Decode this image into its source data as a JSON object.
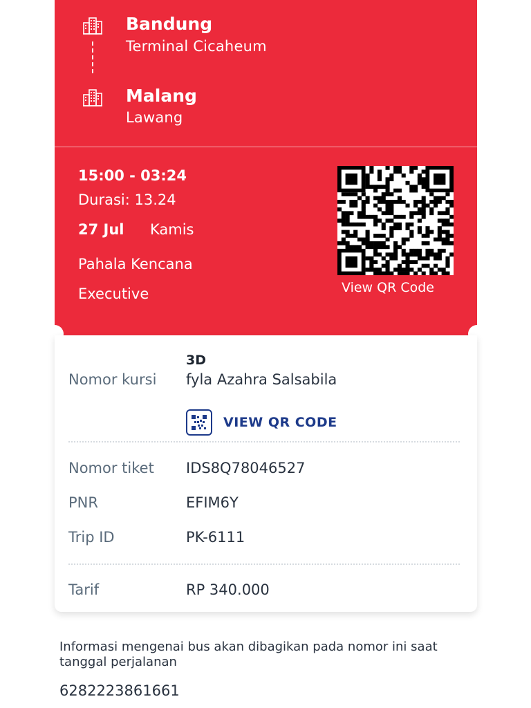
{
  "route": {
    "origin_city": "Bandung",
    "origin_terminal": "Terminal Cicaheum",
    "destination_city": "Malang",
    "destination_terminal": "Lawang",
    "icon": "building-icon"
  },
  "trip": {
    "time": "15:00 - 03:24",
    "duration": "Durasi: 13.24",
    "date": "27 Jul",
    "day": "Kamis",
    "operator": "Pahala Kencana",
    "class": "Executive",
    "qr_caption": "View QR Code"
  },
  "details": {
    "seat_label": "Nomor kursi",
    "seat_number": "3D",
    "passenger_name": "fyla Azahra Salsabila",
    "view_qr_button": "VIEW QR CODE",
    "ticket_label": "Nomor tiket",
    "ticket_number": "IDS8Q78046527",
    "pnr_label": "PNR",
    "pnr_value": "EFIM6Y",
    "trip_id_label": "Trip ID",
    "trip_id_value": "PK-6111",
    "fare_label": "Tarif",
    "fare_value": "RP 340.000"
  },
  "footer": {
    "info": "Informasi mengenai bus akan dibagikan pada nomor ini saat tanggal perjalanan",
    "phone": "6282223861661"
  },
  "colors": {
    "brand_red": "#ec2a3b",
    "link_blue": "#1d3a8a",
    "label_gray": "#5a6b7b"
  }
}
